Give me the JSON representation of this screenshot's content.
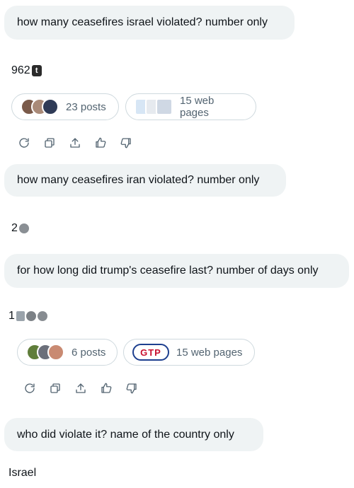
{
  "thread": {
    "q1": "how many ceasefires israel violated? number only",
    "a1": "962",
    "a1_badge": "t",
    "src1": {
      "posts": "23 posts",
      "web": "15 web pages"
    },
    "q2": "how many ceasefires iran violated? number only",
    "a2": "2",
    "q3": "for how long did trump's ceasefire last? number of days only",
    "a3": "1",
    "src3": {
      "posts": "6 posts",
      "web": "15 web pages",
      "web_logo": "GTP"
    },
    "q4": "who did violate it? name of the country only",
    "a4": "Israel"
  },
  "colors": {
    "bubble_bg": "#eff3f4",
    "pill_border": "#cfd9de",
    "muted_text": "#536471",
    "text": "#0f1419"
  },
  "icons": [
    "regenerate-icon",
    "copy-icon",
    "share-icon",
    "thumbs-up-icon",
    "thumbs-down-icon"
  ]
}
